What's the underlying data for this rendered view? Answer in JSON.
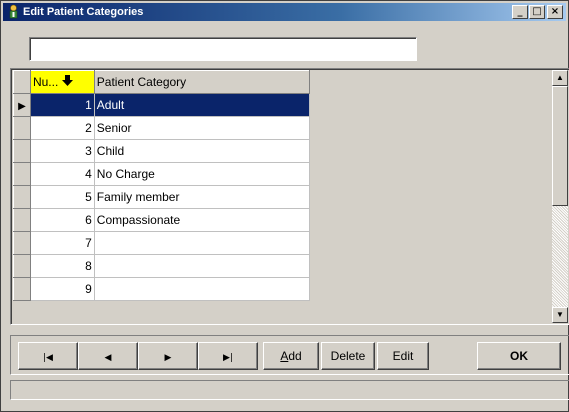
{
  "window": {
    "title": "Edit Patient Categories",
    "controls": {
      "minimize": "_",
      "maximize": "□",
      "close": "×"
    },
    "icon": "app-icon"
  },
  "search": {
    "value": "",
    "placeholder": ""
  },
  "grid": {
    "columns": {
      "number": "Nu...",
      "category": "Patient Category"
    },
    "sort_indicator_icon": "arrow-down-icon",
    "selected_row": 1,
    "rows": [
      {
        "number": "1",
        "category": "Adult"
      },
      {
        "number": "2",
        "category": "Senior"
      },
      {
        "number": "3",
        "category": "Child"
      },
      {
        "number": "4",
        "category": "No Charge"
      },
      {
        "number": "5",
        "category": "Family member"
      },
      {
        "number": "6",
        "category": "Compassionate"
      },
      {
        "number": "7",
        "category": ""
      },
      {
        "number": "8",
        "category": ""
      },
      {
        "number": "9",
        "category": ""
      }
    ]
  },
  "toolbar": {
    "first_icon": "first-record-icon",
    "prev_icon": "previous-record-icon",
    "next_icon": "next-record-icon",
    "last_icon": "last-record-icon",
    "add_accel": "A",
    "add_rest": "dd",
    "delete_label": "Delete",
    "edit_label": "Edit",
    "ok_label": "OK"
  },
  "colors": {
    "selection": "#0a246a",
    "sort_header": "#ffff00",
    "titlebar": "#0a246a"
  }
}
